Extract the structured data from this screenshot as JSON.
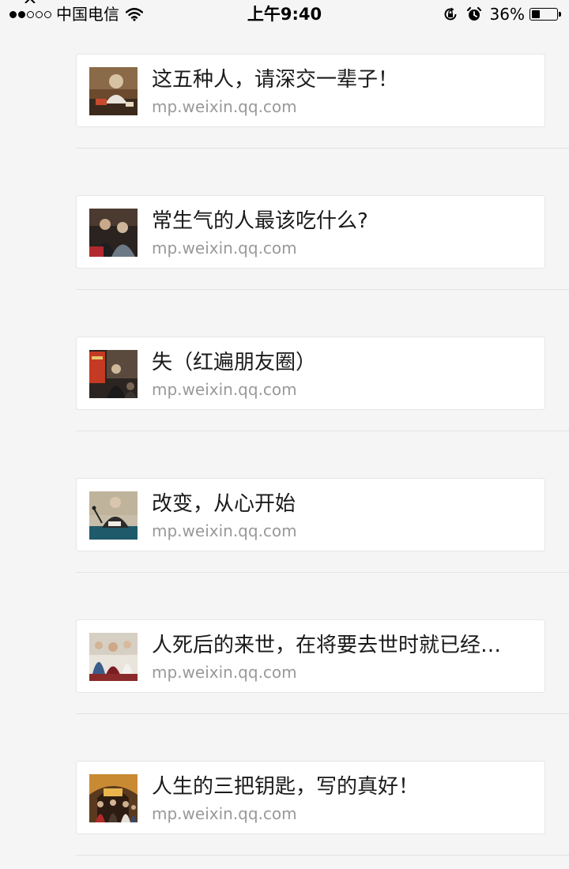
{
  "status_bar": {
    "carrier": "中国电信",
    "time": "上午9:40",
    "battery_percent": "36%",
    "battery_level": 0.36,
    "signal_strength": 2,
    "signal_max": 5,
    "icons": [
      "wifi-icon",
      "rotation-lock-icon",
      "alarm-icon",
      "battery-icon"
    ]
  },
  "feed": {
    "items": [
      {
        "title": "这五种人，请深交一辈子！",
        "source": "mp.weixin.qq.com",
        "thumb_icon": "article-thumbnail-icon"
      },
      {
        "title": "常生气的人最该吃什么?",
        "source": "mp.weixin.qq.com",
        "thumb_icon": "article-thumbnail-icon"
      },
      {
        "title": "失（红遍朋友圈）",
        "source": "mp.weixin.qq.com",
        "thumb_icon": "article-thumbnail-icon"
      },
      {
        "title": "改变，从心开始",
        "source": "mp.weixin.qq.com",
        "thumb_icon": "article-thumbnail-icon"
      },
      {
        "title": "人死后的来世，在将要去世时就已经…",
        "source": "mp.weixin.qq.com",
        "thumb_icon": "article-thumbnail-icon"
      },
      {
        "title": "人生的三把钥匙，写的真好！",
        "source": "mp.weixin.qq.com",
        "thumb_icon": "article-thumbnail-icon"
      }
    ]
  },
  "colors": {
    "background": "#f5f5f5",
    "card": "#ffffff",
    "title_text": "#1a1a1a",
    "source_text": "#999999"
  }
}
